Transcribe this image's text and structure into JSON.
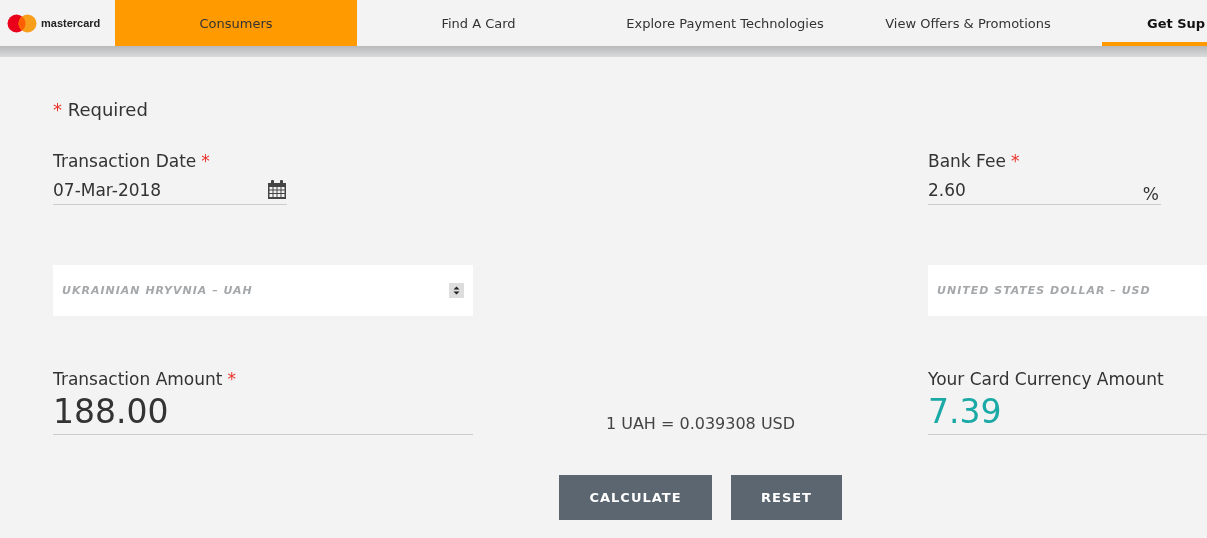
{
  "nav": {
    "logo": "mastercard",
    "tabs": [
      {
        "label": "Consumers",
        "selected": true,
        "underlined": false
      },
      {
        "label": "Find A Card",
        "selected": false,
        "underlined": false
      },
      {
        "label": "Explore Payment Technologies",
        "selected": false,
        "underlined": false
      },
      {
        "label": "View Offers & Promotions",
        "selected": false,
        "underlined": false
      },
      {
        "label": "Get Sup",
        "selected": false,
        "underlined": true
      }
    ]
  },
  "form": {
    "required_mark": "*",
    "required_note": "Required",
    "transaction_date": {
      "label": "Transaction Date",
      "required": true,
      "value": "07-Mar-2018"
    },
    "bank_fee": {
      "label": "Bank Fee",
      "required": true,
      "value": "2.60",
      "unit": "%"
    },
    "from_currency": {
      "value": "UKRAINIAN HRYVNIA – UAH"
    },
    "to_currency": {
      "value": "UNITED STATES DOLLAR – USD"
    },
    "transaction_amount": {
      "label": "Transaction Amount",
      "required": true,
      "value": "188.00"
    },
    "rate": "1 UAH = 0.039308 USD",
    "card_amount": {
      "label": "Your Card Currency Amount",
      "required": false,
      "value": "7.39"
    },
    "buttons": [
      "CALCULATE",
      "RESET"
    ]
  }
}
